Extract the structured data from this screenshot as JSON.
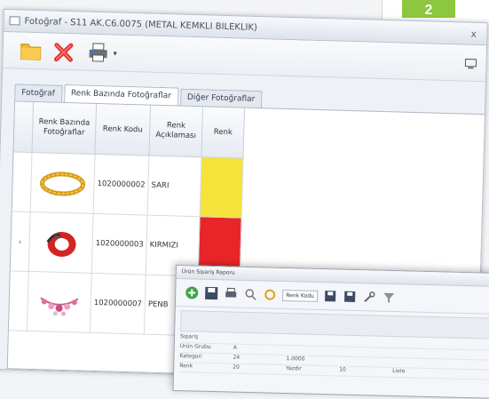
{
  "badge": "2",
  "window": {
    "title": "Fotoğraf - S11 AK.C6.0075 (METAL KEMKLİ BİLEKLİK)",
    "close": "x"
  },
  "toolbar": {
    "icons": [
      "folder-icon",
      "delete-icon",
      "printer-icon",
      "chevron-down-icon",
      "screen-icon"
    ],
    "dropdown_arrow": "▾"
  },
  "tabs": [
    {
      "label": "Fotoğraf",
      "active": false
    },
    {
      "label": "Renk Bazında Fotoğraflar",
      "active": true
    },
    {
      "label": "Diğer Fotoğraflar",
      "active": false
    }
  ],
  "grid": {
    "headers": {
      "photo": "Renk Bazında Fotoğraflar",
      "code": "Renk Kodu",
      "desc": "Renk Açıklaması",
      "color": "Renk"
    },
    "rows": [
      {
        "indicator": "",
        "photo": "gold-chain-bracelet",
        "code": "1020000002",
        "desc": "SARI",
        "color": "#f5e33a"
      },
      {
        "indicator": "›",
        "photo": "red-cuff-bracelet",
        "code": "1020000003",
        "desc": "KIRMIZI",
        "color": "#e8262a"
      },
      {
        "indicator": "",
        "photo": "pink-charm-bracelet",
        "code": "1020000007",
        "desc": "PENB",
        "color": "#ee86b4"
      }
    ]
  },
  "child_window": {
    "title": "Ürün Sipariş Raporu",
    "toolbar_label": "Renk Kodu",
    "grid_rows": [
      [
        "Sipariş",
        "",
        "",
        "",
        ""
      ],
      [
        "Ürün Grubu",
        "A",
        "",
        "",
        ""
      ],
      [
        "Kategori",
        "24",
        "1.0000",
        "",
        ""
      ],
      [
        "Renk",
        "20",
        "Yazdır",
        "10",
        "Liste"
      ]
    ]
  }
}
